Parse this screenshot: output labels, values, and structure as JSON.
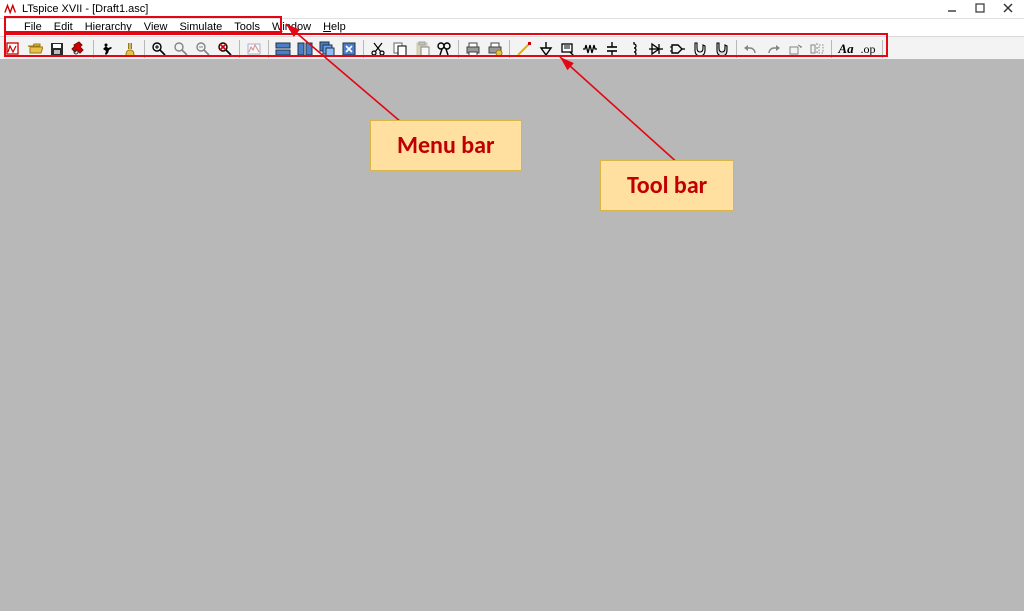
{
  "window": {
    "title": "LTspice XVII - [Draft1.asc]"
  },
  "menu": {
    "items": [
      {
        "label": "File",
        "accel": "F"
      },
      {
        "label": "Edit",
        "accel": "E"
      },
      {
        "label": "Hierarchy",
        "accel": "H"
      },
      {
        "label": "View",
        "accel": "V"
      },
      {
        "label": "Simulate",
        "accel": "S"
      },
      {
        "label": "Tools",
        "accel": "T"
      },
      {
        "label": "Window",
        "accel": "W"
      },
      {
        "label": "Help",
        "accel": "H"
      }
    ]
  },
  "toolbar": {
    "buttons": [
      {
        "name": "new-schematic",
        "enabled": true,
        "sep_after": false
      },
      {
        "name": "open",
        "enabled": true,
        "sep_after": false
      },
      {
        "name": "save",
        "enabled": true,
        "sep_after": false
      },
      {
        "name": "control-panel",
        "enabled": true,
        "sep_after": true
      },
      {
        "name": "run",
        "enabled": true,
        "sep_after": false
      },
      {
        "name": "halt",
        "enabled": true,
        "sep_after": true
      },
      {
        "name": "zoom-in",
        "enabled": true,
        "sep_after": false
      },
      {
        "name": "pan",
        "enabled": false,
        "sep_after": false
      },
      {
        "name": "zoom-out",
        "enabled": false,
        "sep_after": false
      },
      {
        "name": "zoom-full",
        "enabled": true,
        "sep_after": true
      },
      {
        "name": "autorange",
        "enabled": false,
        "sep_after": true
      },
      {
        "name": "tile-horiz",
        "enabled": true,
        "sep_after": false
      },
      {
        "name": "tile-vert",
        "enabled": true,
        "sep_after": false
      },
      {
        "name": "cascade",
        "enabled": true,
        "sep_after": false
      },
      {
        "name": "close-win",
        "enabled": true,
        "sep_after": true
      },
      {
        "name": "cut",
        "enabled": true,
        "sep_after": false
      },
      {
        "name": "copy",
        "enabled": true,
        "sep_after": false
      },
      {
        "name": "paste",
        "enabled": false,
        "sep_after": false
      },
      {
        "name": "find",
        "enabled": true,
        "sep_after": true
      },
      {
        "name": "print",
        "enabled": true,
        "sep_after": false
      },
      {
        "name": "print-setup",
        "enabled": true,
        "sep_after": true
      },
      {
        "name": "draw-wire",
        "enabled": true,
        "sep_after": false
      },
      {
        "name": "ground",
        "enabled": true,
        "sep_after": false
      },
      {
        "name": "net-label",
        "enabled": true,
        "sep_after": false
      },
      {
        "name": "resistor",
        "enabled": true,
        "sep_after": false
      },
      {
        "name": "capacitor",
        "enabled": true,
        "sep_after": false
      },
      {
        "name": "inductor",
        "enabled": true,
        "sep_after": false
      },
      {
        "name": "diode",
        "enabled": true,
        "sep_after": false
      },
      {
        "name": "component",
        "enabled": true,
        "sep_after": false
      },
      {
        "name": "move",
        "enabled": true,
        "sep_after": false
      },
      {
        "name": "drag",
        "enabled": true,
        "sep_after": true
      },
      {
        "name": "undo",
        "enabled": false,
        "sep_after": false
      },
      {
        "name": "redo",
        "enabled": false,
        "sep_after": false
      },
      {
        "name": "rotate",
        "enabled": false,
        "sep_after": false
      },
      {
        "name": "mirror",
        "enabled": false,
        "sep_after": true
      },
      {
        "name": "place-text",
        "enabled": true,
        "sep_after": false
      },
      {
        "name": "spice-directive",
        "enabled": true,
        "sep_after": true
      }
    ]
  },
  "annotations": {
    "menu_label": "Menu bar",
    "tool_label": "Tool bar"
  },
  "colors": {
    "annotation_red": "#e30613",
    "callout_bg": "#ffe0a0",
    "callout_text": "#c00000"
  }
}
